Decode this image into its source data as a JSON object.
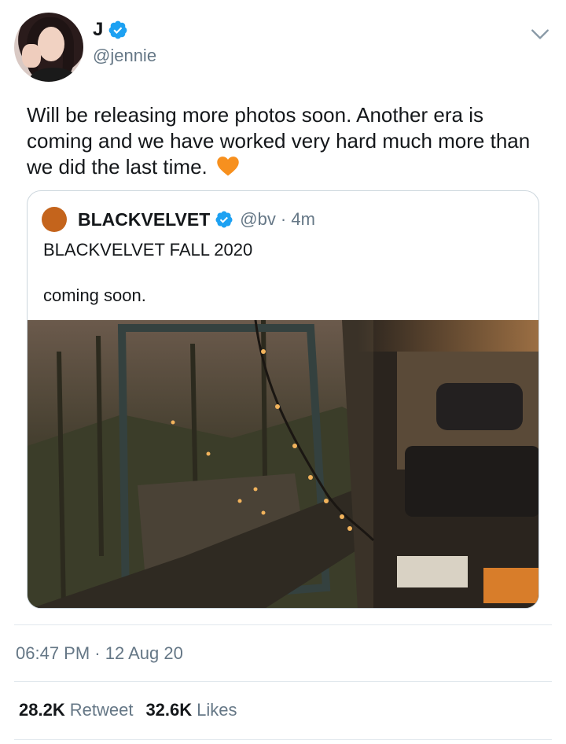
{
  "author": {
    "display_name": "J",
    "handle": "@jennie",
    "avatar_icon": "profile-photo",
    "verified_icon": "verified-badge-icon"
  },
  "tweet": {
    "text": "Will be releasing more photos soon. Another era is coming and we have worked very hard much more than we did the last time.",
    "emoji": "orange-heart"
  },
  "quoted_tweet": {
    "display_name": "BLACKVELVET",
    "handle_time": "@bv · 4m",
    "line1": "BLACKVELVET FALL 2020",
    "line2": "coming soon.",
    "avatar_color": "#c4641c",
    "media": "car-interior-photo"
  },
  "timestamp": "06:47 PM · 12 Aug 20",
  "stats": {
    "retweets": "28.2K",
    "retweets_label": "Retweet",
    "likes": "32.6K",
    "likes_label": "Likes"
  },
  "colors": {
    "verified": "#1da1f2",
    "secondary_text": "#657786",
    "divider": "#e1e8ed"
  }
}
